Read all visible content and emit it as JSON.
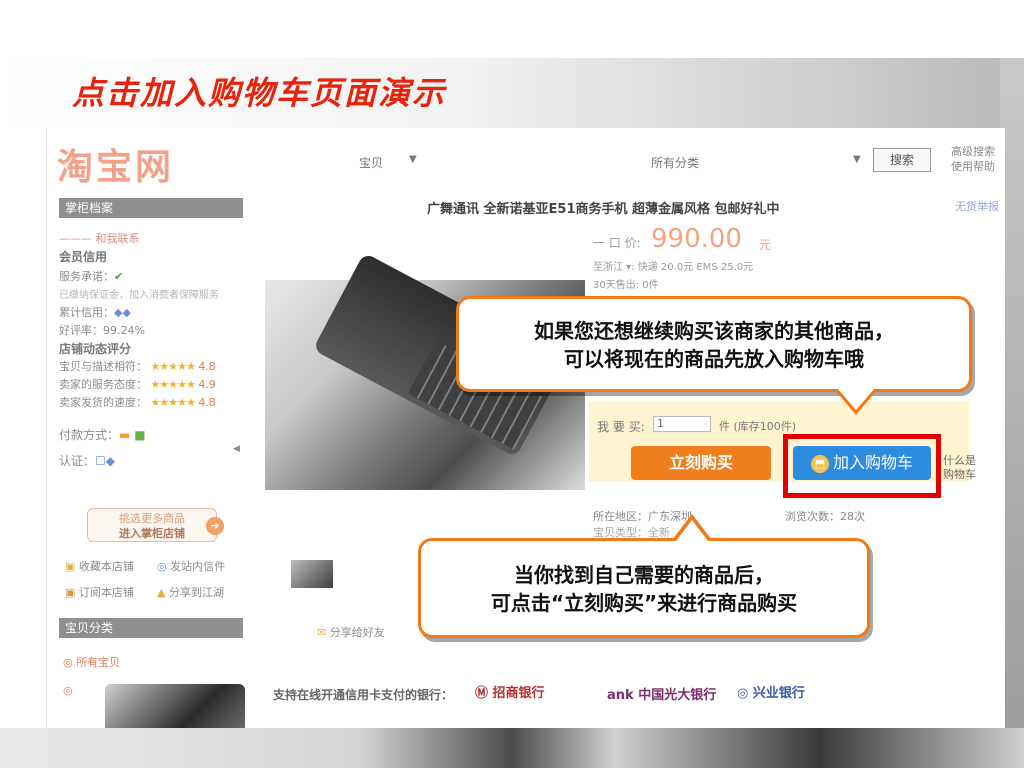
{
  "slide": {
    "title": "点击加入购物车页面演示"
  },
  "header": {
    "logo": "淘宝网",
    "search_category": "宝贝",
    "all_categories": "所有分类",
    "search_button": "搜索",
    "advanced_search": "高级搜索",
    "help": "使用帮助"
  },
  "sidebar": {
    "seller_profile": "掌柜档案",
    "contact": "和我联系",
    "member_credit": "会员信用",
    "service_promise": "服务承诺：",
    "consumer_guarantee": "已缴纳保证金，加入消费者保障服务",
    "cumulative_credit": "累计信用：",
    "positive_rate": "好评率：99.24%",
    "shop_rating": "店铺动态评分",
    "ratings": [
      {
        "label": "宝贝与描述相符：",
        "stars": "★★★★★",
        "score": "4.8"
      },
      {
        "label": "卖家的服务态度：",
        "stars": "★★★★★",
        "score": "4.9"
      },
      {
        "label": "卖家发货的速度：",
        "stars": "★★★★★",
        "score": "4.8"
      }
    ],
    "payment": "付款方式：",
    "certification": "认证：",
    "more_items_line1": "挑选更多商品",
    "more_items_line2": "进入掌柜店铺",
    "collect_shop": "收藏本店铺",
    "send_message": "发站内信件",
    "subscribe_shop": "订阅本店铺",
    "share_to": "分享到江湖",
    "item_categories": "宝贝分类",
    "all_items": "所有宝贝"
  },
  "product": {
    "title": "广舞通讯 全新诺基亚E51商务手机 超薄金属风格 包邮好礼中",
    "report": "无货举报",
    "price_label": "一 口 价:",
    "price": "990.00",
    "price_unit": "元",
    "shipping": "至浙江 ▾: 快递 20.0元  EMS 25.0元",
    "sold_30_days": "30天售出: 0件",
    "qty_label": "我 要 买:",
    "qty_value": "1",
    "stock": "件 (库存100件)",
    "buy_now": "立刻购买",
    "add_to_cart": "加入购物车",
    "what_is_cart_1": "什么是",
    "what_is_cart_2": "购物车",
    "region": "所在地区：广东深圳",
    "views": "浏览次数：28次",
    "category": "宝贝类型：全新",
    "share": "分享给好友"
  },
  "banks": {
    "label": "支持在线开通信用卡支付的银行：",
    "list": [
      "招商银行",
      "ank 中国光大银行",
      "兴业银行"
    ]
  },
  "callouts": {
    "cart_line1": "如果您还想继续购买该商家的其他商品，",
    "cart_line2": "可以将现在的商品先放入购物车哦",
    "buy_line1": "当你找到自己需要的商品后，",
    "buy_line2": "可点击“立刻购买”来进行商品购买"
  },
  "colors": {
    "title": "#e8220b",
    "callout_border": "#f07a1a",
    "highlight": "#e50000",
    "cart_button": "#2d8be0",
    "buy_button": "#f07e1c"
  }
}
